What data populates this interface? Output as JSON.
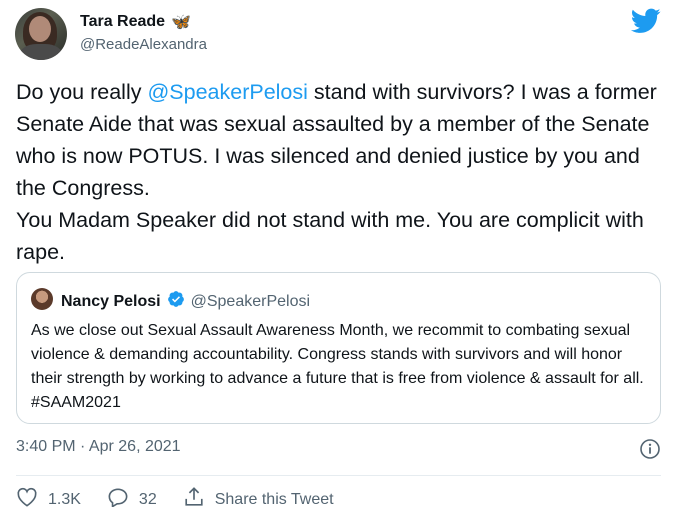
{
  "author": {
    "name": "Tara Reade",
    "emoji": "🦋",
    "handle": "@ReadeAlexandra"
  },
  "tweet": {
    "text_pre": "Do you really ",
    "mention": "@SpeakerPelosi",
    "text_post": " stand with survivors? I was a former Senate Aide that was sexual assaulted by a member of the Senate who is now POTUS. I was silenced and denied justice by you and the Congress.\nYou Madam Speaker did not stand with me. You are complicit with rape."
  },
  "quoted": {
    "name": "Nancy Pelosi",
    "handle": "@SpeakerPelosi",
    "text": "As we close out Sexual Assault Awareness Month, we recommit to combating sexual violence & demanding accountability. Congress stands with survivors and will honor their strength by working to advance a future that is free from violence & assault for all. #SAAM2021"
  },
  "timestamp": "3:40 PM · Apr 26, 2021",
  "actions": {
    "likes": "1.3K",
    "replies": "32",
    "share_label": "Share this Tweet"
  },
  "colors": {
    "accent": "#1d9bf0",
    "verified": "#1d9bf0",
    "secondary_text": "#536471",
    "border": "#cfd9de"
  },
  "icons": [
    "butterfly-emoji",
    "twitter-bird-icon",
    "verified-badge-icon",
    "info-icon",
    "heart-icon",
    "reply-icon",
    "share-icon"
  ]
}
